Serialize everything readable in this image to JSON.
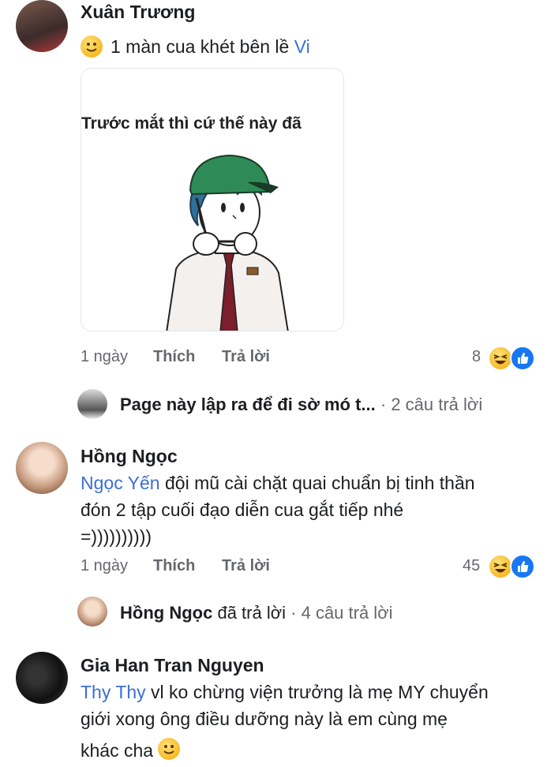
{
  "comments": [
    {
      "author": "Xuân Trương",
      "text_parts": {
        "emoji": "emoji-slight-smile",
        "text": "1 màn cua khét bên lề",
        "mention": "Vi"
      },
      "sticker": {
        "caption": "Trước mắt thì cứ thế này đã"
      },
      "time": "1 ngày",
      "like_label": "Thích",
      "reply_label": "Trả lời",
      "reaction_count": "8",
      "reply_thread": {
        "author": "Page này lập ra để đi sờ mó t...",
        "count_text": "· 2 câu trả lời"
      }
    },
    {
      "author": "Hồng Ngọc",
      "mention": "Ngọc Yến",
      "line1": "đội mũ cài chặt quai chuẩn bị tinh thần",
      "line2": "đón 2 tập cuối đạo diễn cua gắt tiếp nhé",
      "line3": "=))))))))))",
      "time": "1 ngày",
      "like_label": "Thích",
      "reply_label": "Trả lời",
      "reaction_count": "45",
      "reply_thread": {
        "author": "Hồng Ngọc",
        "action": "đã trả lời",
        "count_text": "· 4 câu trả lời"
      }
    },
    {
      "author": "Gia Han Tran Nguyen",
      "mention": "Thy Thy",
      "line1": "vl ko chừng viện trưởng là mẹ MY chuyển",
      "line2": "giới xong ông điều dưỡng này là em cùng mẹ",
      "line3": "khác cha"
    }
  ],
  "icons": {
    "haha": "haha-reaction-icon",
    "like": "like-reaction-icon"
  },
  "colors": {
    "link": "#3b6fd6",
    "meta": "#65676b",
    "like_blue": "#1877f2",
    "haha_yellow": "#f7b928"
  }
}
